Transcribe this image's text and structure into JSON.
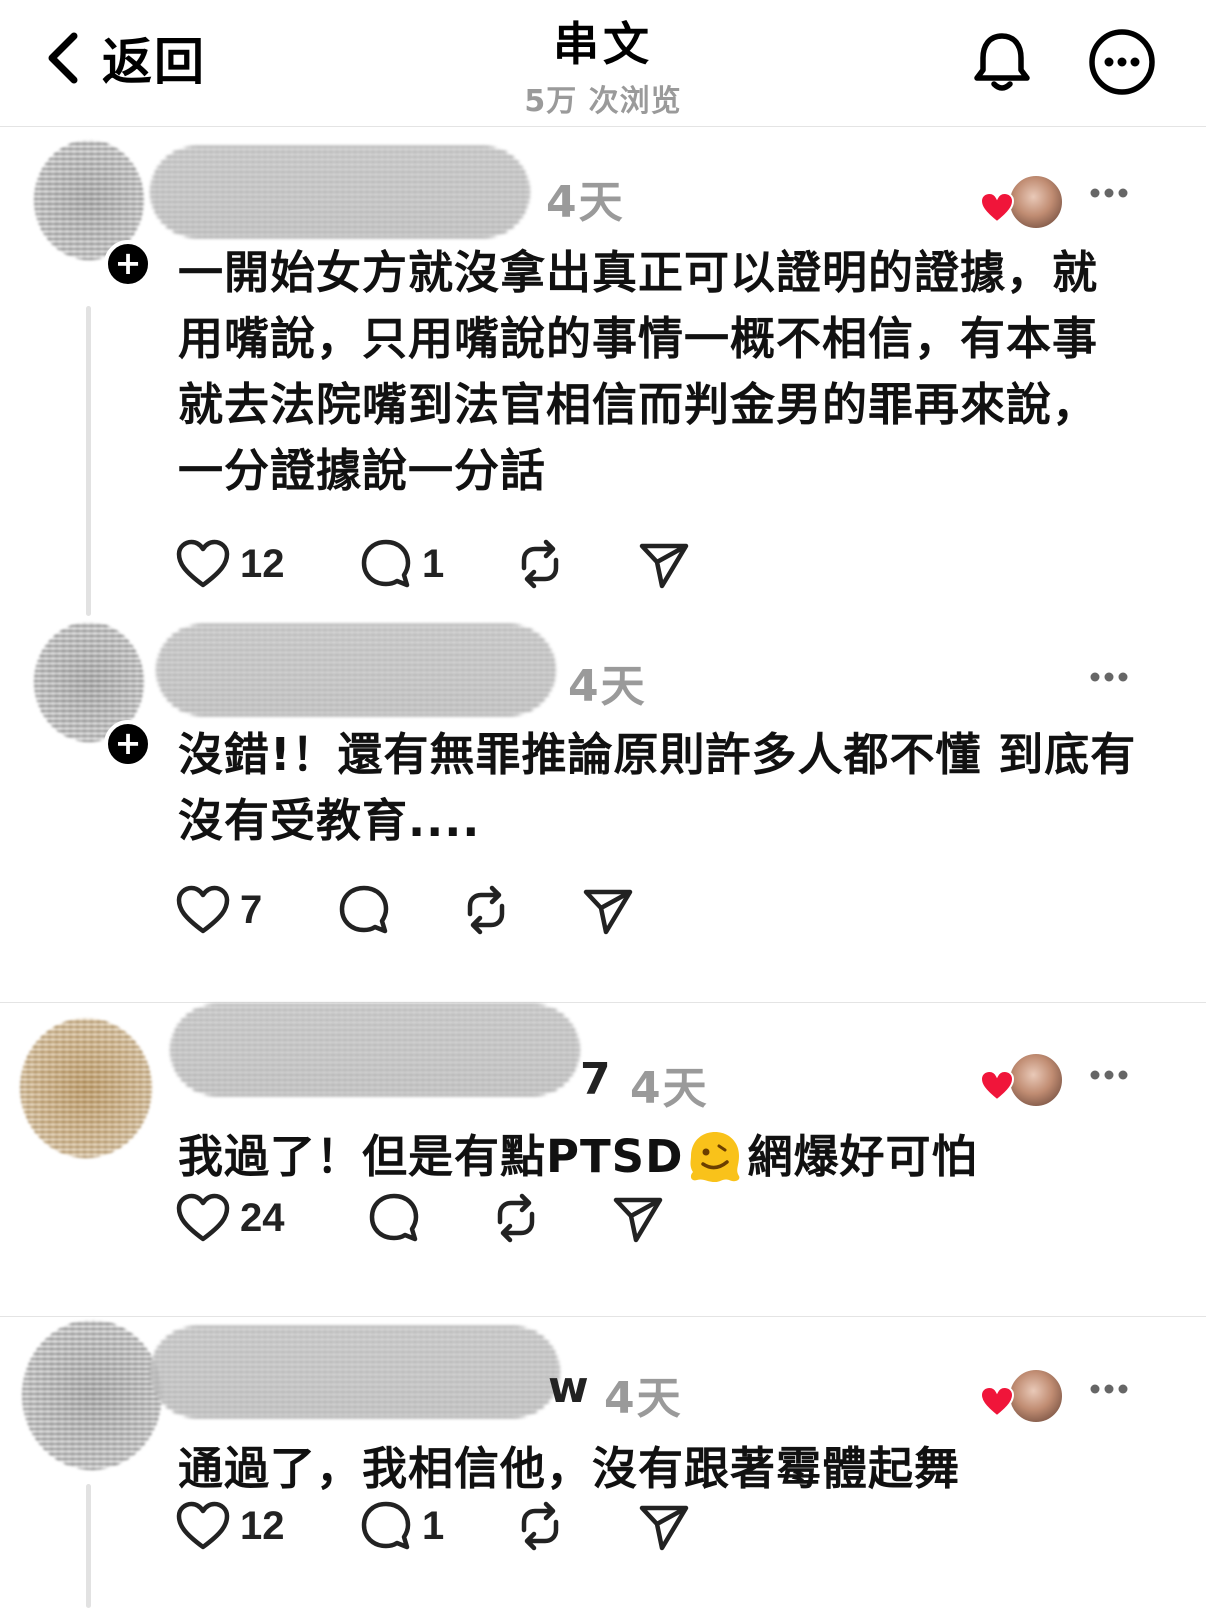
{
  "header": {
    "back_label": "返回",
    "title": "串文",
    "views": "5万 次浏览"
  },
  "icons": {
    "back": "chevron-left-icon",
    "bell": "bell-icon",
    "more": "more-circle-icon",
    "like": "heart-outline-icon",
    "reply": "comment-bubble-icon",
    "repost": "repost-icon",
    "share": "send-icon"
  },
  "colors": {
    "heart_red": "#f0153a",
    "muted_text": "#9a9a9a",
    "divider": "#e4e4e4"
  },
  "comments": [
    {
      "name_suffix": "",
      "time": "4天",
      "text": "一開始女方就沒拿出真正可以證明的證據，就用嘴說，只用嘴說的事情一概不相信，有本事就去法院嘴到法官相信而判金男的罪再來說，一分證據說一分話",
      "likes": "12",
      "replies": "1",
      "liked_by_author": true
    },
    {
      "name_suffix": "",
      "time": "4天",
      "text": "沒錯!！還有無罪推論原則許多人都不懂 到底有沒有受教育....",
      "likes": "7",
      "replies": "",
      "liked_by_author": false
    },
    {
      "name_suffix": "7",
      "time": "4天",
      "text_before": "我過了！但是有點PTSD",
      "text_after": "網爆好可怕",
      "emoji": "melting-face-emoji",
      "likes": "24",
      "replies": "",
      "liked_by_author": true
    },
    {
      "name_suffix": "w",
      "time": "4天",
      "text": "通過了，我相信他，沒有跟著霉體起舞",
      "likes": "12",
      "replies": "1",
      "liked_by_author": true
    }
  ]
}
